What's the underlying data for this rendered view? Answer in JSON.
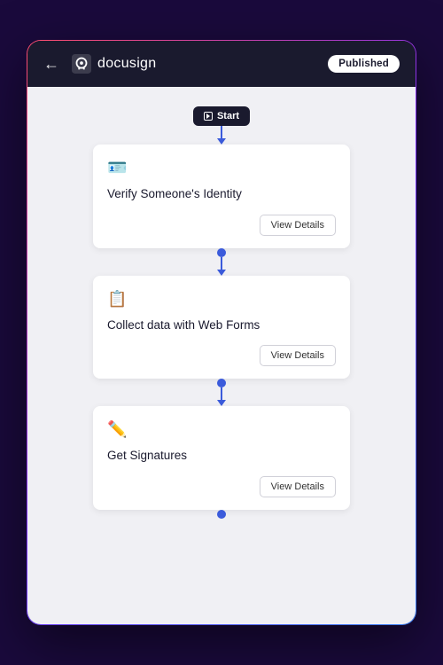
{
  "topbar": {
    "back_label": "←",
    "logo_text": "docusign",
    "published_label": "Published"
  },
  "flow": {
    "start_label": "Start",
    "steps": [
      {
        "id": "verify-identity",
        "icon": "🪪",
        "title": "Verify Someone's Identity",
        "button_label": "View Details"
      },
      {
        "id": "collect-data",
        "icon": "📋",
        "title": "Collect data with Web Forms",
        "button_label": "View Details"
      },
      {
        "id": "get-signatures",
        "icon": "✏️",
        "title": "Get Signatures",
        "button_label": "View Details"
      }
    ]
  }
}
